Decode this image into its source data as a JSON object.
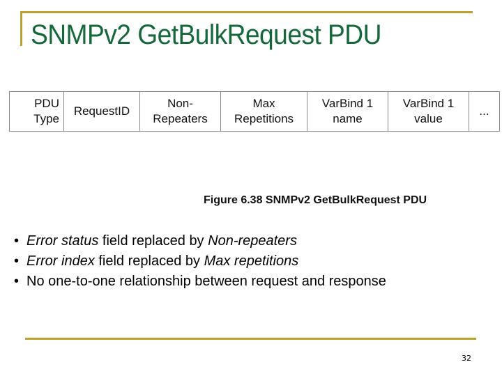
{
  "slide": {
    "title": "SNMPv2 GetBulkRequest PDU",
    "page_number": "32",
    "accent_color": "#BFA030",
    "title_color": "#15683A"
  },
  "pdu_table": {
    "cells": [
      {
        "line1": "PDU",
        "line2": "Type"
      },
      {
        "line1": "RequestID",
        "line2": ""
      },
      {
        "line1": "Non-",
        "line2": "Repeaters"
      },
      {
        "line1": "Max",
        "line2": "Repetitions"
      },
      {
        "line1": "VarBind 1",
        "line2": "name"
      },
      {
        "line1": "VarBind 1",
        "line2": "value"
      },
      {
        "line1": "...",
        "line2": ""
      }
    ]
  },
  "figure_caption": "Figure 6.38 SNMPv2 GetBulkRequest PDU",
  "bullets": [
    {
      "bullet": "•",
      "em1": "Error status",
      "text1": " field replaced by ",
      "em2": "Non-repeaters",
      "text2": ""
    },
    {
      "bullet": "•",
      "em1": "Error index",
      "text1": " field replaced by ",
      "em2": "Max repetitions",
      "text2": ""
    },
    {
      "bullet": "•",
      "em1": "",
      "text1": "No one-to-one relationship between request and response",
      "em2": "",
      "text2": ""
    }
  ]
}
